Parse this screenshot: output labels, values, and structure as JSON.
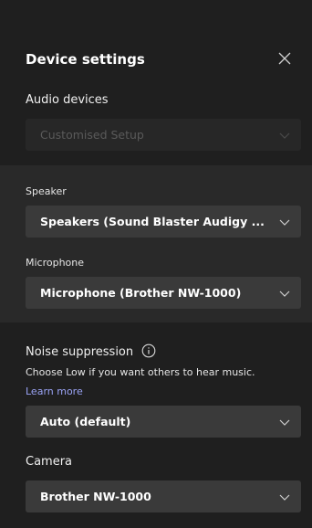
{
  "header": {
    "title": "Device settings"
  },
  "audio": {
    "section_label": "Audio devices",
    "setup_value": "Customised Setup"
  },
  "speaker": {
    "label": "Speaker",
    "value": "Speakers (Sound Blaster Audigy ..."
  },
  "microphone": {
    "label": "Microphone",
    "value": "Microphone (Brother NW-1000)"
  },
  "noise": {
    "label": "Noise suppression",
    "hint": "Choose Low if you want others to hear music.",
    "learn_more": "Learn more",
    "value": "Auto (default)"
  },
  "camera": {
    "label": "Camera",
    "value": "Brother NW-1000"
  },
  "icons": {
    "close": "close-icon",
    "chevron": "chevron-down-icon",
    "info": "info-icon"
  },
  "colors": {
    "background": "#1f1f1f",
    "panel_mid": "#292929",
    "dropdown": "#3a3a3a",
    "link": "#9aa3f5"
  }
}
